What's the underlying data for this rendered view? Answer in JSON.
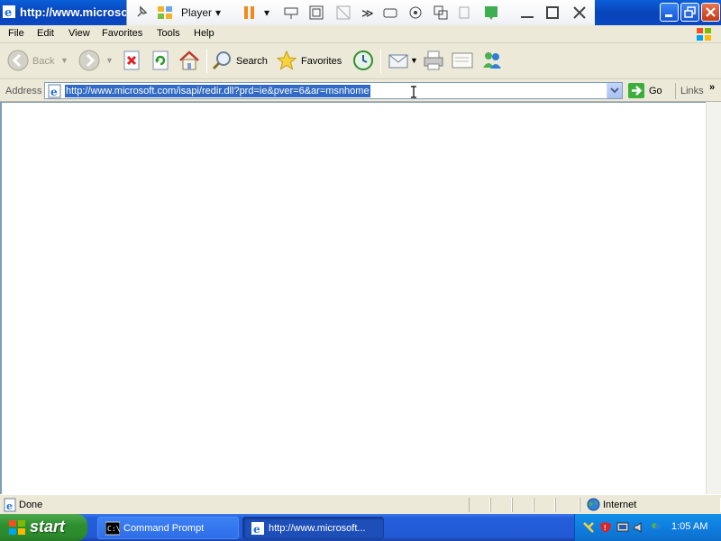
{
  "window": {
    "title": "http://www.microsoft",
    "player_label": "Player"
  },
  "menu": [
    "File",
    "Edit",
    "View",
    "Favorites",
    "Tools",
    "Help"
  ],
  "toolbar": {
    "back_label": "Back",
    "search_label": "Search",
    "favorites_label": "Favorites"
  },
  "address": {
    "label": "Address",
    "url": "http://www.microsoft.com/isapi/redir.dll?prd=ie&pver=6&ar=msnhome",
    "go_label": "Go",
    "links_label": "Links",
    "links_more": "»"
  },
  "status": {
    "text": "Done",
    "zone": "Internet"
  },
  "taskbar": {
    "start_label": "start",
    "tasks": [
      {
        "label": "Command Prompt",
        "icon": "console-icon",
        "active": false
      },
      {
        "label": "http://www.microsoft...",
        "icon": "ie-icon",
        "active": true
      }
    ],
    "clock": "1:05 AM"
  },
  "colors": {
    "titlebar": "#0a4fc8",
    "selection": "#316ac5",
    "taskbar": "#245edb",
    "start_button": "#2f8f2f",
    "tray": "#0f7ee0"
  }
}
